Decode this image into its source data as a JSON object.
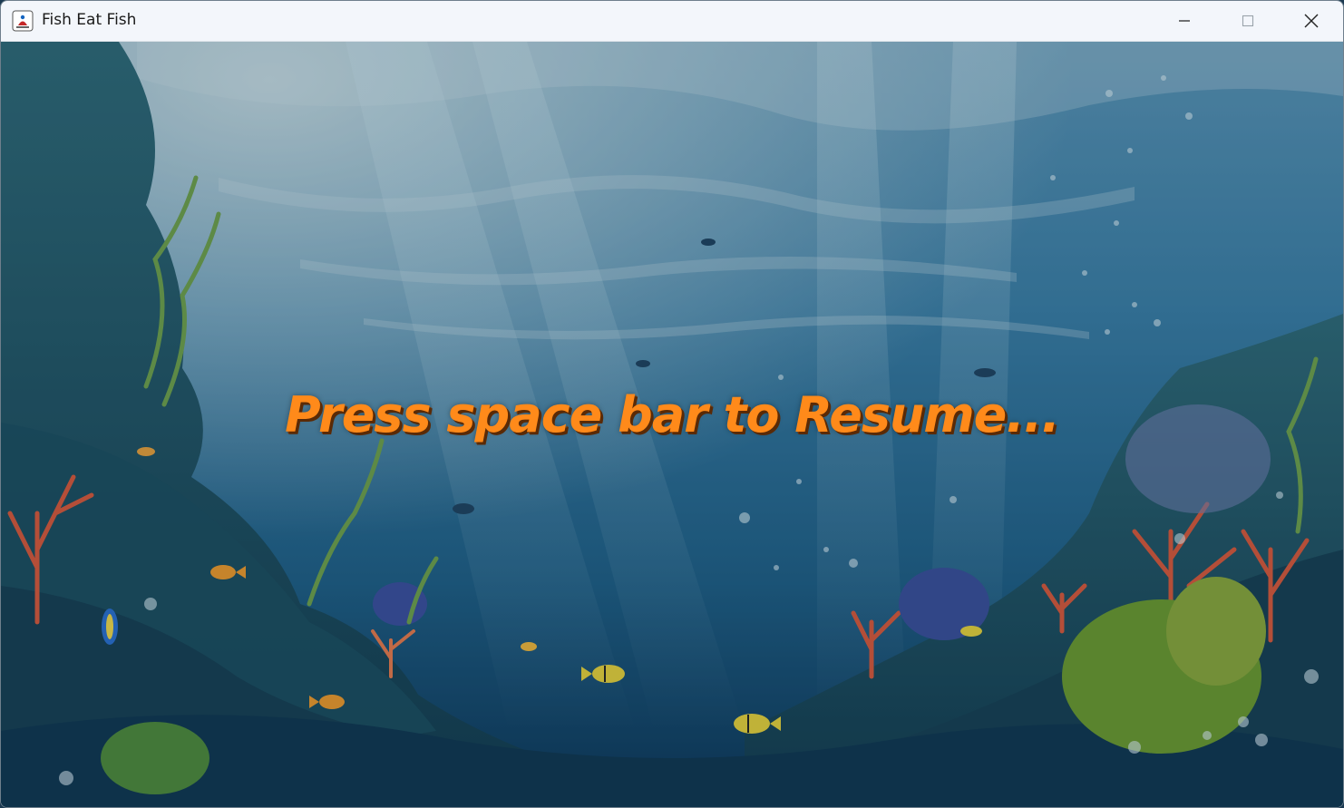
{
  "window": {
    "title": "Fish Eat Fish"
  },
  "controls": {
    "minimize_icon": "minimize-icon",
    "maximize_icon": "maximize-icon",
    "close_icon": "close-icon"
  },
  "game": {
    "pause_message": "Press space bar to Resume..."
  },
  "colors": {
    "message": "#ff8a1a",
    "message_shadow": "#5a2a06",
    "water_top": "#4f8fb2",
    "water_bottom": "#0f3f64"
  }
}
